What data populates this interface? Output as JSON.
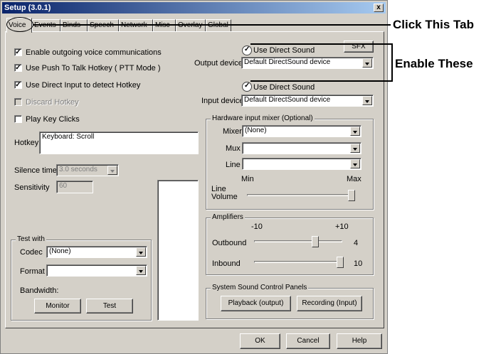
{
  "window": {
    "title": "Setup (3.0.1)",
    "close_glyph": "x"
  },
  "tabs": [
    {
      "label": "Voice",
      "active": true
    },
    {
      "label": "Events"
    },
    {
      "label": "Binds"
    },
    {
      "label": "Speech"
    },
    {
      "label": "Network"
    },
    {
      "label": "Misc"
    },
    {
      "label": "Overlay"
    },
    {
      "label": "Global"
    }
  ],
  "voice": {
    "enable_outgoing": {
      "label": "Enable outgoing voice communications",
      "checked": "✓"
    },
    "push_to_talk": {
      "label": "Use Push To Talk Hotkey ( PTT Mode )",
      "checked": "✓"
    },
    "direct_input": {
      "label": "Use Direct Input to detect Hotkey",
      "checked": "✓"
    },
    "discard_hotkey": {
      "label": "Discard Hotkey"
    },
    "play_key_clicks": {
      "label": "Play Key Clicks"
    },
    "hotkey": {
      "label": "Hotkey",
      "value": "Keyboard: Scroll"
    },
    "silence_time": {
      "label": "Silence time",
      "value": "3.0 seconds"
    },
    "sensitivity": {
      "label": "Sensitivity",
      "value": "60"
    }
  },
  "output": {
    "use_direct_sound": "Use Direct Sound",
    "sfx_label": "SFX",
    "device_label": "Output device",
    "device_value": "Default DirectSound device"
  },
  "input": {
    "use_direct_sound": "Use Direct Sound",
    "device_label": "Input device",
    "device_value": "Default DirectSound device"
  },
  "mixer": {
    "title": "Hardware input mixer (Optional)",
    "mixer_label": "Mixer",
    "mixer_value": "(None)",
    "mux_label": "Mux",
    "mux_value": "",
    "line_label": "Line",
    "line_value": "",
    "min_label": "Min",
    "max_label": "Max",
    "line_volume_label": "Line",
    "line_volume_label2": "Volume",
    "line_volume": 1.0
  },
  "amplifiers": {
    "title": "Amplifiers",
    "min_label": "-10",
    "max_label": "+10",
    "outbound_label": "Outbound",
    "outbound_value": "4",
    "inbound_label": "Inbound",
    "inbound_value": "10"
  },
  "test": {
    "title": "Test with",
    "codec_label": "Codec",
    "codec_value": "(None)",
    "format_label": "Format",
    "format_value": "",
    "bandwidth_label": "Bandwidth:",
    "monitor_button": "Monitor",
    "test_button": "Test"
  },
  "sound_panels": {
    "title": "System Sound Control Panels",
    "playback_button": "Playback (output)",
    "recording_button": "Recording (Input)"
  },
  "footer": {
    "ok": "OK",
    "cancel": "Cancel",
    "help": "Help"
  },
  "annotations": {
    "click_tab": "Click This Tab",
    "enable_these": "Enable These"
  }
}
